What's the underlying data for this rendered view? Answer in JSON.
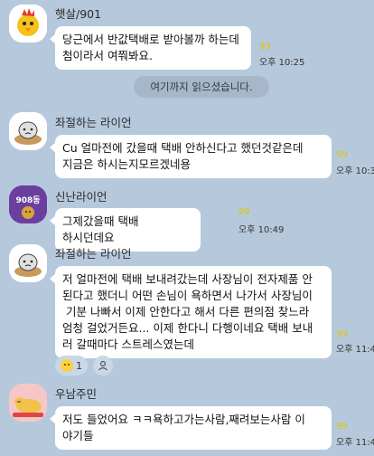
{
  "messages": [
    {
      "sender": "햇살/901",
      "avatar_icon": "chick-avatar-icon",
      "lines": "당근에서 반값택배로 받아볼까 하는데\n첨이라서 여쭤봐요.",
      "unread": "99",
      "time": "오후 10:25"
    },
    {
      "sender": "좌절하는 라이언",
      "avatar_icon": "lion-avatar-icon",
      "lines": "Cu 얼마전에 갔을때 택배 안하신다고 했던것같은데\n지금은 하시는지모르겠네용",
      "unread": "99",
      "time": "오후 10:3"
    },
    {
      "sender": "신난라이언",
      "avatar_badge": "908동",
      "lines": "그제갔을때 택배 하시던데요",
      "unread": "99",
      "time": "오후 10:49"
    },
    {
      "sender": "좌절하는 라이언",
      "avatar_icon": "lion-avatar-icon",
      "lines": "저 얼마전에 택배 보내려갔는데 사장님이 전자제품 안\n된다고 했더니 어떤 손님이 욕하면서 나가서 사장님이\n 기분 나빠서 이제 안한다고 해서 다른 편의점 찾느라\n엄청 걸었거든요... 이제 한다니 다행이네요 택배 보내\n러 갈때마다 스트레스였는데",
      "unread": "99",
      "time": "오후 11:4"
    },
    {
      "sender": "우남주민",
      "avatar_icon": "sleeping-dog-avatar-icon",
      "lines": "저도 들었어요 ㅋㅋ욕하고가는사람,째려보는사람 이\n야기들",
      "unread": "99",
      "time": "오후 11:4"
    }
  ],
  "divider": "여기까지 읽으셨습니다.",
  "reactions": {
    "emoji": "crying-face-icon",
    "count": "1",
    "person_icon": "person-icon"
  },
  "colors": {
    "background": "#b6c9dc",
    "unread": "#e1c300",
    "bubble": "#ffffff"
  }
}
